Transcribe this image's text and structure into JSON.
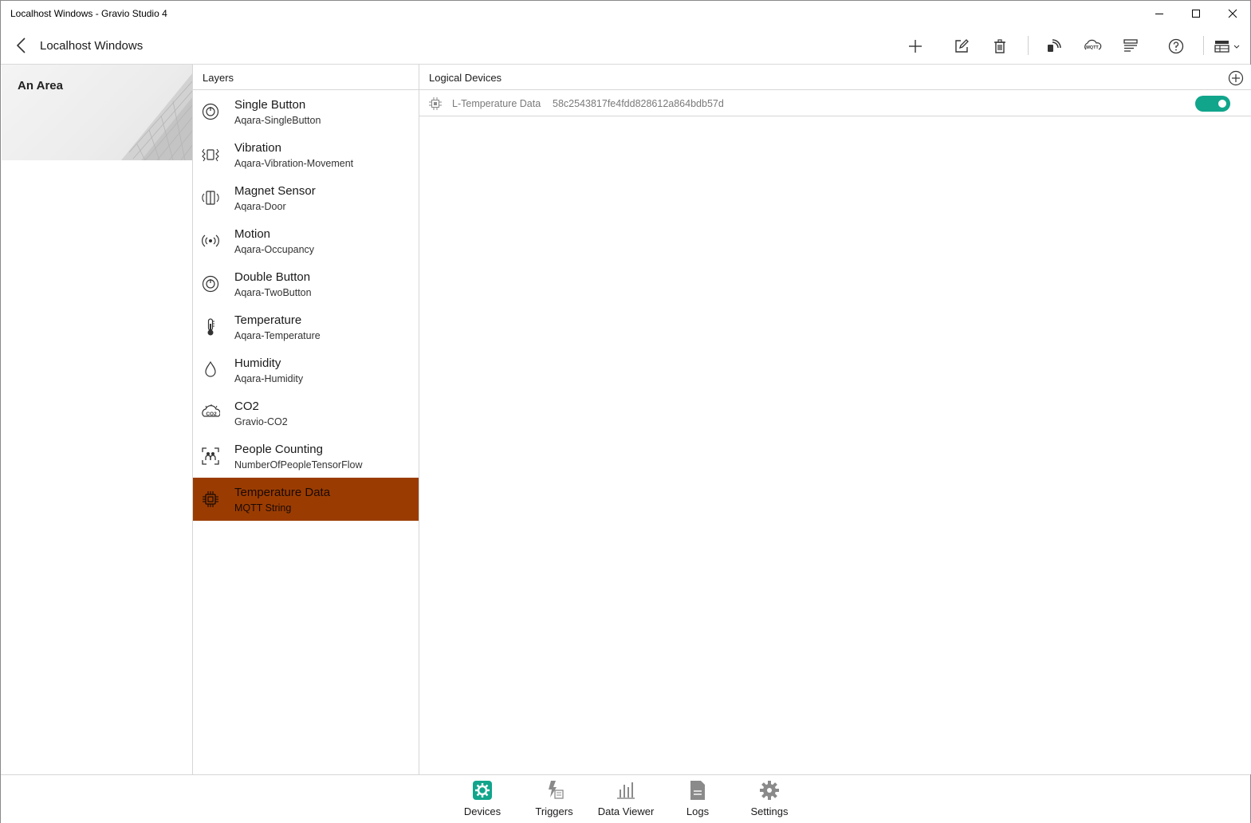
{
  "window": {
    "title": "Localhost Windows - Gravio Studio 4"
  },
  "header": {
    "title": "Localhost Windows",
    "toolbar": [
      "add-icon",
      "edit-icon",
      "delete-icon",
      "nfc-icon",
      "mqtt-icon",
      "list-icon",
      "help-icon",
      "view-options-icon"
    ],
    "mqtt_label": "MQTT"
  },
  "area": {
    "name": "An Area"
  },
  "layers": {
    "header": "Layers",
    "items": [
      {
        "name": "Single Button",
        "sub": "Aqara-SingleButton",
        "icon": "power-button-icon"
      },
      {
        "name": "Vibration",
        "sub": "Aqara-Vibration-Movement",
        "icon": "vibration-icon"
      },
      {
        "name": "Magnet Sensor",
        "sub": "Aqara-Door",
        "icon": "magnet-sensor-icon"
      },
      {
        "name": "Motion",
        "sub": "Aqara-Occupancy",
        "icon": "motion-icon"
      },
      {
        "name": "Double Button",
        "sub": "Aqara-TwoButton",
        "icon": "power-button-icon"
      },
      {
        "name": "Temperature",
        "sub": "Aqara-Temperature",
        "icon": "thermometer-icon"
      },
      {
        "name": "Humidity",
        "sub": "Aqara-Humidity",
        "icon": "droplet-icon"
      },
      {
        "name": "CO2",
        "sub": "Gravio-CO2",
        "icon": "co2-icon"
      },
      {
        "name": "People Counting",
        "sub": "NumberOfPeopleTensorFlow",
        "icon": "people-counting-icon"
      },
      {
        "name": "Temperature Data",
        "sub": "MQTT String",
        "icon": "chip-icon",
        "selected": true
      }
    ],
    "selected_color": "#9a3c02"
  },
  "devices": {
    "header": "Logical Devices",
    "rows": [
      {
        "name": "L-Temperature Data",
        "id": "58c2543817fe4fdd828612a864bdb57d",
        "enabled": true
      }
    ],
    "toggle_color": "#11a58c"
  },
  "nav": {
    "items": [
      {
        "label": "Devices",
        "icon": "devices-icon",
        "active": true
      },
      {
        "label": "Triggers",
        "icon": "triggers-icon"
      },
      {
        "label": "Data Viewer",
        "icon": "data-viewer-icon"
      },
      {
        "label": "Logs",
        "icon": "logs-icon"
      },
      {
        "label": "Settings",
        "icon": "settings-icon"
      }
    ],
    "active_color": "#11a58c"
  },
  "co2_label": "CO2"
}
